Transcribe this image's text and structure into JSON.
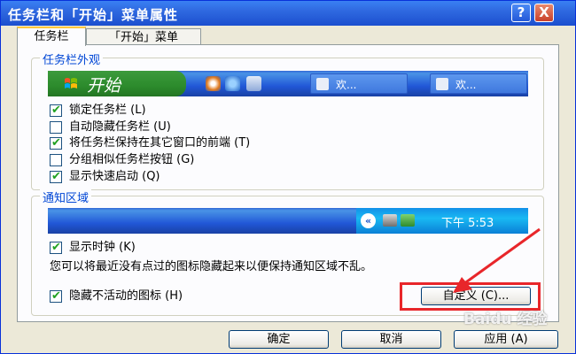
{
  "window": {
    "title": "任务栏和「开始」菜单属性"
  },
  "titlebar": {
    "help_label": "?",
    "close_label": "X"
  },
  "tabs": [
    {
      "label": "任务栏",
      "active": true
    },
    {
      "label": "「开始」菜单",
      "active": false
    }
  ],
  "appearance_group": {
    "label": "任务栏外观",
    "preview": {
      "start_label": "开始",
      "task_items": [
        "欢...",
        "欢..."
      ]
    },
    "options": [
      {
        "label": "锁定任务栏 (L)",
        "checked": true
      },
      {
        "label": "自动隐藏任务栏 (U)",
        "checked": false
      },
      {
        "label": "将任务栏保持在其它窗口的前端 (T)",
        "checked": true
      },
      {
        "label": "分组相似任务栏按钮 (G)",
        "checked": false
      },
      {
        "label": "显示快速启动 (Q)",
        "checked": true
      }
    ]
  },
  "notify_group": {
    "label": "通知区域",
    "preview": {
      "chevron": "«",
      "clock": "下午 5:53"
    },
    "show_clock": {
      "label": "显示时钟 (K)",
      "checked": true
    },
    "description": "您可以将最近没有点过的图标隐藏起来以便保持通知区域不乱。",
    "hide_inactive": {
      "label": "隐藏不活动的图标 (H)",
      "checked": true
    },
    "customize_label": "自定义 (C)..."
  },
  "footer": {
    "ok_label": "确定",
    "cancel_label": "取消",
    "apply_label": "应用 (A)"
  },
  "watermark": "Baidu 经验",
  "colors": {
    "titlebar": "#2F69E0",
    "dialog_bg": "#ECE9D8",
    "highlight_box": "#E8262A",
    "group_label": "#0046D5"
  }
}
